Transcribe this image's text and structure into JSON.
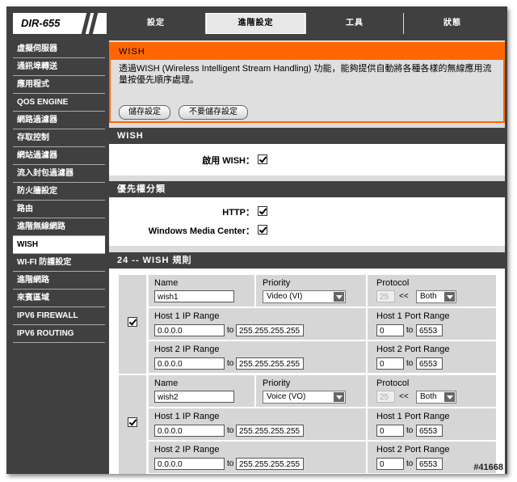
{
  "header": {
    "model": "DIR-655",
    "tabs": [
      {
        "label": "設定"
      },
      {
        "label": "進階設定"
      },
      {
        "label": "工具"
      },
      {
        "label": "狀態"
      }
    ]
  },
  "sidebar": {
    "items": [
      {
        "label": "虛擬伺服器"
      },
      {
        "label": "通訊埠轉送"
      },
      {
        "label": "應用程式"
      },
      {
        "label": "QOS ENGINE"
      },
      {
        "label": "網路過濾器"
      },
      {
        "label": "存取控制"
      },
      {
        "label": "網站過濾器"
      },
      {
        "label": "流入封包過濾器"
      },
      {
        "label": "防火牆設定"
      },
      {
        "label": "路由"
      },
      {
        "label": "進階無線網路"
      },
      {
        "label": "WISH"
      },
      {
        "label": "WI-FI 防護設定"
      },
      {
        "label": "進階網路"
      },
      {
        "label": "來賓區域"
      },
      {
        "label": "IPV6 FIREWALL"
      },
      {
        "label": "IPV6 ROUTING"
      }
    ]
  },
  "intro": {
    "title": "WISH",
    "description": "透過WISH (Wireless Intelligent Stream Handling) 功能，能夠提供自動將各種各樣的無線應用流量按優先順序處理。",
    "save_label": "儲存設定",
    "dont_save_label": "不要儲存設定"
  },
  "wish": {
    "title": "WISH",
    "enable_label": "啟用 WISH：",
    "enabled": true
  },
  "priority": {
    "title": "優先權分類",
    "http_label": "HTTP：",
    "http_checked": true,
    "wmc_label": "Windows Media Center：",
    "wmc_checked": true
  },
  "rules": {
    "title": "24 -- WISH 規則",
    "to_label": "to",
    "proto_sep": "<<",
    "rows": [
      {
        "enabled": true,
        "name_caption": "Name",
        "name": "wish1",
        "priority_caption": "Priority",
        "priority": "Video (VI)",
        "protocol_caption": "Protocol",
        "protocol_num": "25",
        "protocol": "Both",
        "host1_caption": "Host 1 IP Range",
        "host1_from": "0.0.0.0",
        "host1_to": "255.255.255.255",
        "host1_port_caption": "Host 1 Port Range",
        "host1_port_from": "0",
        "host1_port_to": "6553",
        "host2_caption": "Host 2 IP Range",
        "host2_from": "0.0.0.0",
        "host2_to": "255.255.255.255",
        "host2_port_caption": "Host 2 Port Range",
        "host2_port_from": "0",
        "host2_port_to": "6553"
      },
      {
        "enabled": true,
        "name_caption": "Name",
        "name": "wish2",
        "priority_caption": "Priority",
        "priority": "Voice (VO)",
        "protocol_caption": "Protocol",
        "protocol_num": "25",
        "protocol": "Both",
        "host1_caption": "Host 1 IP Range",
        "host1_from": "0.0.0.0",
        "host1_to": "255.255.255.255",
        "host1_port_caption": "Host 1 Port Range",
        "host1_port_from": "0",
        "host1_port_to": "6553",
        "host2_caption": "Host 2 IP Range",
        "host2_from": "0.0.0.0",
        "host2_to": "255.255.255.255",
        "host2_port_caption": "Host 2 Port Range",
        "host2_port_from": "0",
        "host2_port_to": "6553"
      }
    ]
  },
  "watermark": "#41668"
}
